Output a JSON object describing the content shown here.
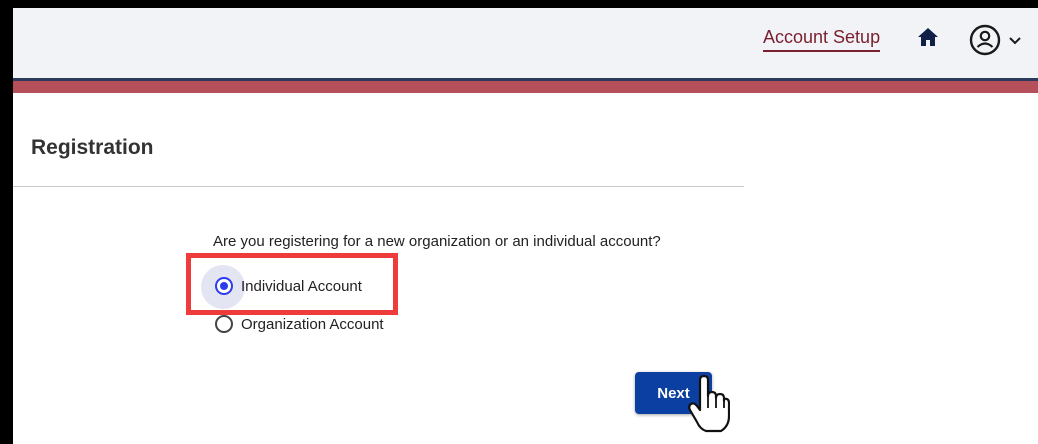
{
  "header": {
    "nav_link": "Account Setup",
    "icons": {
      "home": "home-icon",
      "user": "user-circle-icon",
      "dropdown": "chevron-down-icon"
    }
  },
  "main": {
    "title": "Registration",
    "question": "Are you registering for a new organization or an individual account?",
    "options": [
      {
        "label": "Individual Account",
        "selected": true
      },
      {
        "label": "Organization Account",
        "selected": false
      }
    ],
    "next_label": "Next"
  },
  "colors": {
    "accent_bar": "#b5505a",
    "nav_link": "#7a1f2f",
    "primary_button": "#0b3fa1",
    "radio_selected": "#2c3df0",
    "highlight_box": "#ee3b3b"
  }
}
